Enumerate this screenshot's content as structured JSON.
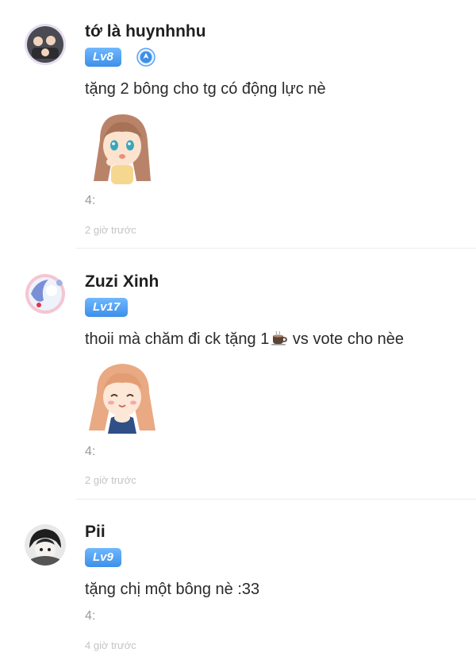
{
  "comments": [
    {
      "username": "tớ là huynhnhu",
      "level": "Lv8",
      "verified_icon": "author-badge-icon",
      "text": "tặng 2 bông cho tg có động lực nè",
      "sticker": "anime-girl-sticker",
      "reply_count": "4:",
      "time": "2 giờ trước"
    },
    {
      "username": "Zuzi Xinh",
      "level": "Lv17",
      "text": "thoii mà chăm đi ck tặng 1",
      "text_suffix": "vs vote cho nèe",
      "sticker": "anime-girl-blushing-sticker",
      "reply_count": "4:",
      "time": "2 giờ trước"
    },
    {
      "username": "Pii",
      "level": "Lv9",
      "text": "tặng chị một bông nè :33",
      "reply_count": "4:",
      "time": "4 giờ trước"
    }
  ],
  "colors": {
    "level_badge": "#3d8fe8",
    "divider": "#ececec",
    "muted_text": "#9a9a9a"
  }
}
